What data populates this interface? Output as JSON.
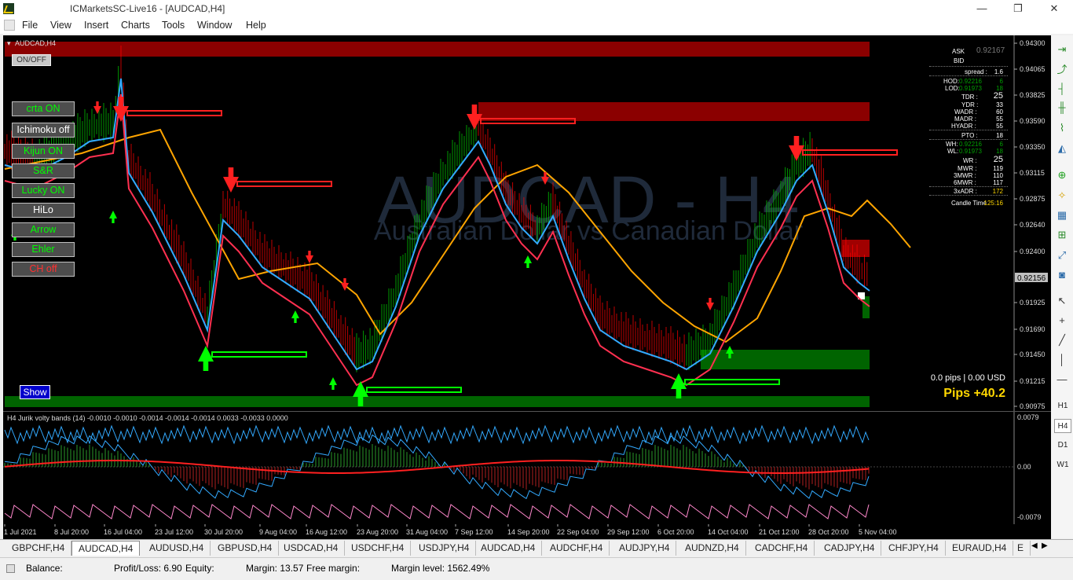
{
  "window": {
    "title": "ICMarketsSC-Live16 - [AUDCAD,H4]",
    "minimize_glyph": "—",
    "restore_glyph": "❐",
    "close_glyph": "✕"
  },
  "menu": [
    "File",
    "View",
    "Insert",
    "Charts",
    "Tools",
    "Window",
    "Help"
  ],
  "chart": {
    "label": "AUDCAD,H4",
    "watermark_symbol": "AUDCAD - H4",
    "watermark_name": "Australian Dollar vs Canadian Dollar",
    "current_price": "0.92156",
    "price_ticks": [
      "0.94300",
      "0.94065",
      "0.93825",
      "0.93590",
      "0.93350",
      "0.93115",
      "0.92875",
      "0.92640",
      "0.92400",
      "0.92156",
      "0.91925",
      "0.91690",
      "0.91450",
      "0.91215",
      "0.90975"
    ],
    "pips_text": "0.0 pips | 0.00 USD",
    "pips_total": "Pips +40.2",
    "colors": {
      "bull": "#00cc00",
      "bear": "#ff0000",
      "ma_orange": "#ffa500",
      "ma_blue": "#33aaff",
      "bands_up": "#00ff00",
      "bands_down": "#ff2020"
    }
  },
  "controls": {
    "onoff": "ON/OFF",
    "buttons": [
      {
        "label": "crta ON",
        "color": "#00ff00"
      },
      {
        "label": "Ichimoku off",
        "color": "#ffffff"
      },
      {
        "label": "Kijun ON",
        "color": "#00ff00"
      },
      {
        "label": "S&R",
        "color": "#00ff00"
      },
      {
        "label": "Lucky ON",
        "color": "#00ff00"
      },
      {
        "label": "HiLo",
        "color": "#ffffff"
      },
      {
        "label": "Arrow",
        "color": "#00ff00"
      },
      {
        "label": "Ehler",
        "color": "#00ff00"
      },
      {
        "label": "CH off",
        "color": "#ff3030"
      }
    ],
    "show": "Show"
  },
  "info_panel": {
    "ask_label": "ASK",
    "ask_value": "0.92167",
    "bid_label": "BID",
    "spread_label": "spread :",
    "spread_value": "1.6",
    "hod_label": "HOD:",
    "hod_price": "0.92216",
    "hod_value": "6",
    "lod_label": "LOD:",
    "lod_price": "0.91973",
    "lod_value": "18",
    "tdr_label": "TDR :",
    "tdr_value": "25",
    "ydr_label": "YDR :",
    "ydr_value": "33",
    "wadr_label": "WADR :",
    "wadr_value": "60",
    "madr_label": "MADR :",
    "madr_value": "55",
    "hyadr_label": "HYADR :",
    "hyadr_value": "55",
    "pto_label": "PTO :",
    "pto_value": "18",
    "wh_label": "WH:",
    "wh_price": "0.92216",
    "wh_value": "6",
    "wl_label": "WL:",
    "wl_price": "0.91973",
    "wl_value": "18",
    "wr_label": "WR :",
    "wr_value": "25",
    "mwr_label": "MWR :",
    "mwr_value": "119",
    "mwr3_label": "3MWR :",
    "mwr3_value": "110",
    "mwr6_label": "6MWR :",
    "mwr6_value": "117",
    "adr3_label": "3xADR :",
    "adr3_value": "172",
    "candle_label": "Candle Time",
    "candle_value": "125:16"
  },
  "indicator": {
    "label": "H4 Jurik volty bands (14) -0.0010 -0.0010 -0.0014 -0.0014 -0.0014 0.0033 -0.0033 0.0000",
    "ticks": [
      "0.0079",
      "0.00",
      "-0.0079"
    ]
  },
  "time_ticks": [
    "1 Jul 2021",
    "8 Jul 20:00",
    "16 Jul 04:00",
    "23 Jul 12:00",
    "30 Jul 20:00",
    "9 Aug 04:00",
    "16 Aug 12:00",
    "23 Aug 20:00",
    "31 Aug 04:00",
    "7 Sep 12:00",
    "14 Sep 20:00",
    "22 Sep 04:00",
    "29 Sep 12:00",
    "6 Oct 20:00",
    "14 Oct 04:00",
    "21 Oct 12:00",
    "28 Oct 20:00",
    "5 Nov 04:00"
  ],
  "tabs": [
    "GBPCHF,H4",
    "AUDCAD,H4",
    "AUDUSD,H4",
    "GBPUSD,H4",
    "USDCAD,H4",
    "USDCHF,H4",
    "USDJPY,H4",
    "AUDCAD,H4",
    "AUDCHF,H4",
    "AUDJPY,H4",
    "AUDNZD,H4",
    "CADCHF,H4",
    "CADJPY,H4",
    "CHFJPY,H4",
    "EURAUD,H4",
    "E"
  ],
  "active_tab": 1,
  "status": {
    "balance": "Balance:",
    "profit": "Profit/Loss: 6.90",
    "equity": "Equity:",
    "margin": "Margin: 13.57",
    "free_margin": "Free margin:",
    "margin_level": "Margin level: 1562.49%"
  },
  "timeframes": [
    "H1",
    "H4",
    "D1",
    "W1"
  ]
}
